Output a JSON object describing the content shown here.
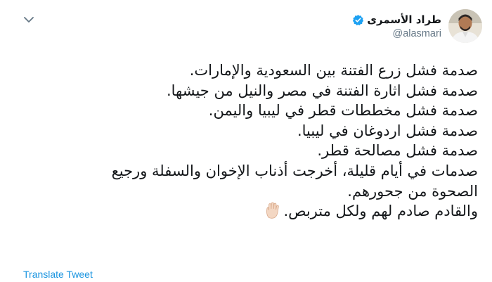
{
  "user": {
    "display_name": "طراد الأسمرى",
    "handle": "@alasmari",
    "verified": true,
    "verified_color": "#1da1f2"
  },
  "tweet": {
    "lines": [
      "صدمة فشل زرع الفتنة بين السعودية والإمارات.",
      "صدمة فشل اثارة الفتنة في مصر والنيل من جيشها.",
      "صدمة فشل مخططات قطر في ليبيا واليمن.",
      "صدمة فشل اردوغان في ليبيا.",
      "صدمة فشل مصالحة قطر.",
      "صدمات في أيام قليلة، أخرجت أذناب الإخوان والسفلة ورجيع",
      "الصحوة من جحورهم.",
      "والقادم صادم لهم ولكل متربص."
    ],
    "emoji": "raised-hand-emoji"
  },
  "actions": {
    "translate_label": "Translate Tweet"
  },
  "icons": {
    "menu": "chevron-down-icon",
    "verified": "verified-badge-icon",
    "avatar": "avatar"
  },
  "colors": {
    "link": "#1b95e0",
    "secondary_text": "#657786",
    "primary_text": "#14171a"
  }
}
